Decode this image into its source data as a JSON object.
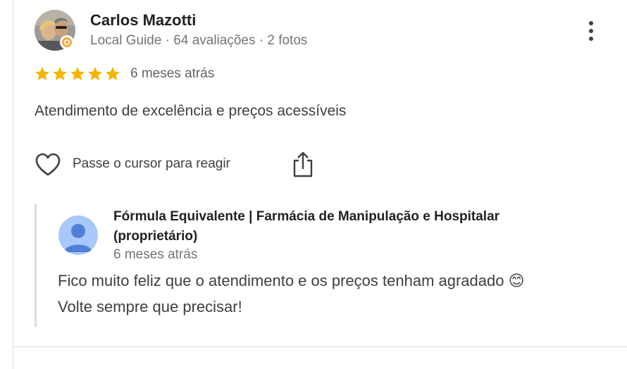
{
  "review": {
    "reviewer_name": "Carlos Mazotti",
    "reviewer_meta": "Local Guide · 64 avaliações · 2 fotos",
    "rating": 5,
    "rating_max": 5,
    "time": "6 meses atrás",
    "text": "Atendimento de excelência e preços acessíveis",
    "react_hint": "Passe o cursor para reagir"
  },
  "owner_reply": {
    "name": "Fórmula Equivalente | Farmácia de Manipulação e Hospitalar (proprietário)",
    "time": "6 meses atrás",
    "text_line_1": "Fico muito feliz que o atendimento e os preços tenham agradado 😊",
    "text_line_2": "Volte sempre que precisar!"
  },
  "icons": {
    "star": "star-icon",
    "menu": "more-vert-icon",
    "like": "heart-outline-icon",
    "share": "share-icon",
    "badge": "local-guide-badge-icon",
    "owner_avatar": "default-person-avatar-icon"
  },
  "colors": {
    "star": "#f4b400",
    "text_primary": "#202124",
    "text_secondary": "#70757a",
    "divider": "#dadce0",
    "owner_avatar_bg": "#a8c7fa",
    "owner_avatar_fg": "#4f7fd6",
    "guide_badge": "#f8a940"
  }
}
